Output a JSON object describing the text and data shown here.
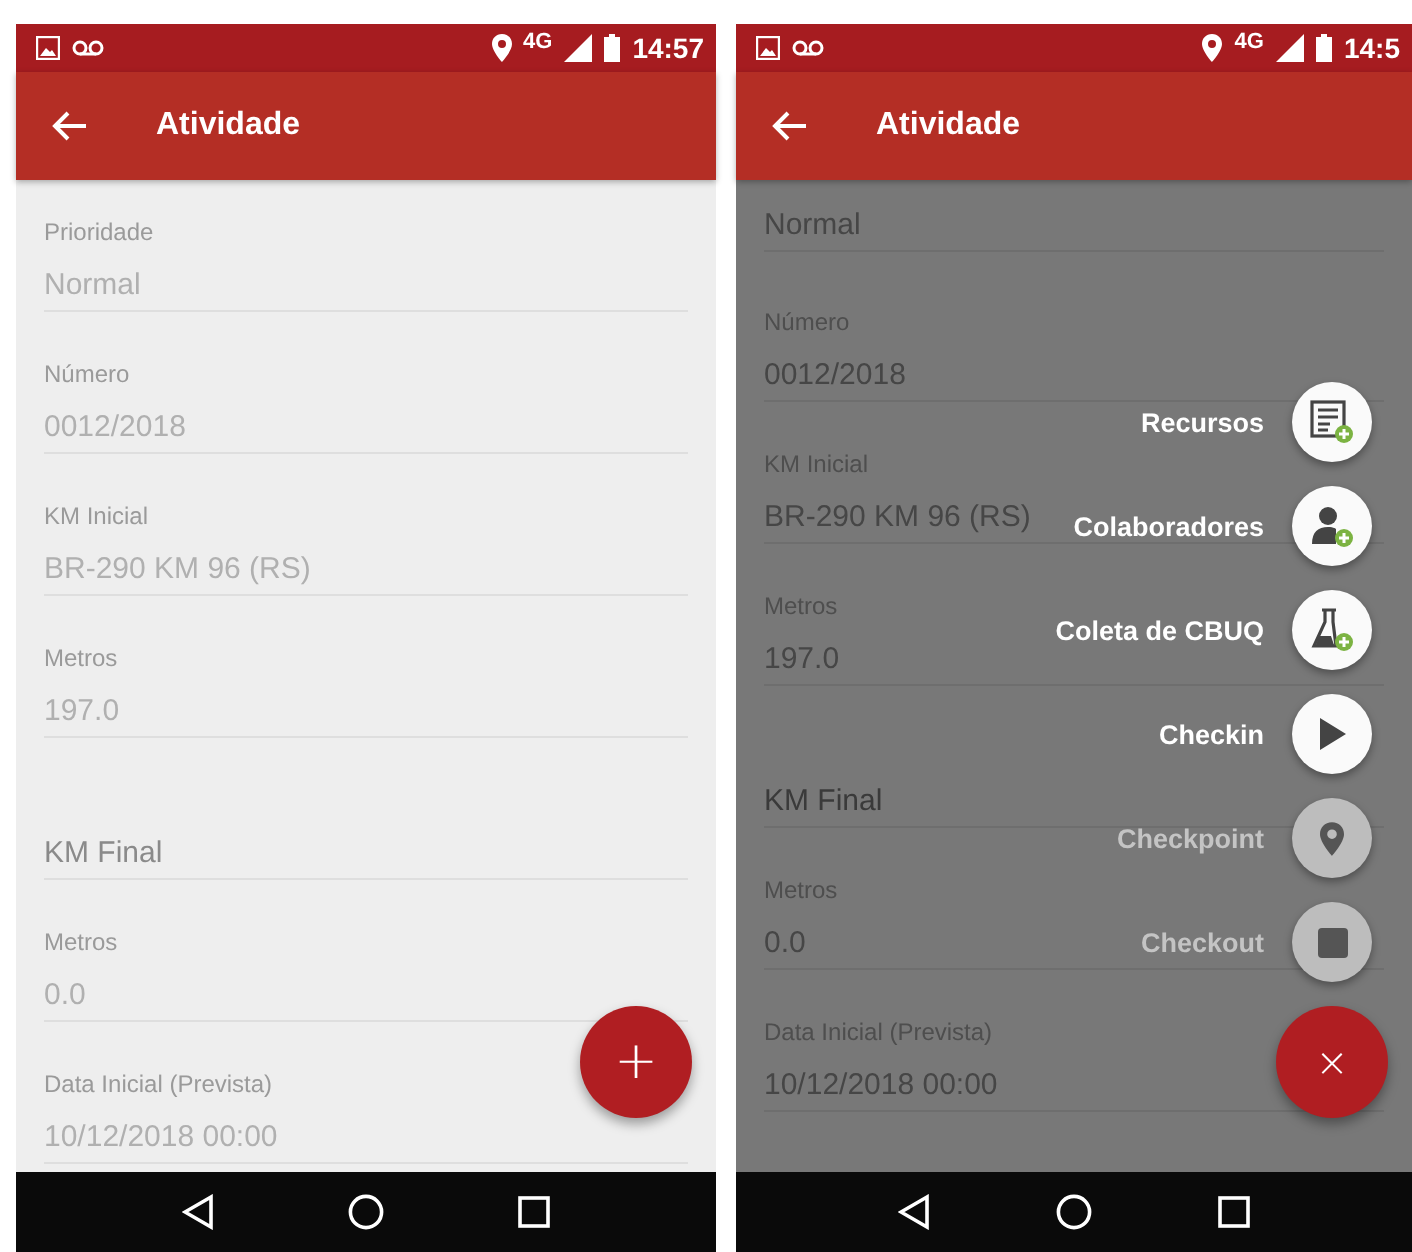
{
  "screens": [
    {
      "status_bar": {
        "network": "4G",
        "time": "14:57"
      },
      "app_bar": {
        "title": "Atividade"
      },
      "fields": [
        {
          "kind": "text",
          "label": "Prioridade",
          "value": "Normal"
        },
        {
          "kind": "text",
          "label": "Número",
          "value": "0012/2018"
        },
        {
          "kind": "text",
          "label": "KM Inicial",
          "value": "BR-290 KM 96 (RS)"
        },
        {
          "kind": "text",
          "label": "Metros",
          "value": "197.0"
        },
        {
          "kind": "hint",
          "placeholder": "KM Final"
        },
        {
          "kind": "text",
          "label": "Metros",
          "value": "0.0"
        },
        {
          "kind": "text",
          "label": "Data Inicial (Prevista)",
          "value": "10/12/2018 00:00"
        }
      ],
      "fab": {
        "symbol": "+",
        "expanded": false
      }
    },
    {
      "status_bar": {
        "network": "4G",
        "time": "14:5"
      },
      "app_bar": {
        "title": "Atividade"
      },
      "fields": [
        {
          "kind": "text",
          "value": "Normal"
        },
        {
          "kind": "text",
          "label": "Número",
          "value": "0012/2018"
        },
        {
          "kind": "text",
          "label": "KM Inicial",
          "value": "BR-290 KM 96 (RS)"
        },
        {
          "kind": "text",
          "label": "Metros",
          "value": "197.0"
        },
        {
          "kind": "hint",
          "placeholder": "KM Final"
        },
        {
          "kind": "text",
          "label": "Metros",
          "value": "0.0"
        },
        {
          "kind": "text",
          "label": "Data Inicial (Prevista)",
          "value": "10/12/2018 00:00"
        }
      ],
      "fab": {
        "symbol": "×",
        "expanded": true
      },
      "fab_menu": [
        {
          "kind": "resources",
          "label": "Recursos",
          "disabled": false
        },
        {
          "kind": "people",
          "label": "Colaboradores",
          "disabled": false
        },
        {
          "kind": "sample",
          "label": "Coleta de CBUQ",
          "disabled": false
        },
        {
          "kind": "checkin",
          "label": "Checkin",
          "disabled": false
        },
        {
          "kind": "checkpoint",
          "label": "Checkpoint",
          "disabled": true
        },
        {
          "kind": "checkout",
          "label": "Checkout",
          "disabled": true
        }
      ]
    }
  ]
}
